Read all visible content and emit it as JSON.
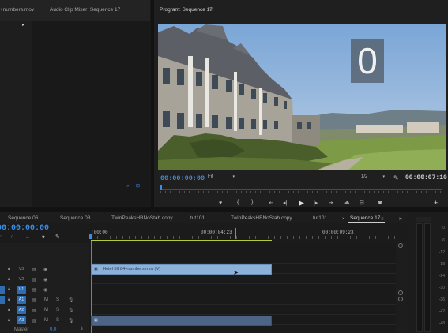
{
  "top_panels": {
    "source_tab": "+numbers.mov",
    "audio_mixer_tab": "Audio Clip Mixer: Sequence 17",
    "program_tab": "Program: Sequence 17"
  },
  "program_monitor": {
    "overlay_number": "0",
    "current_timecode": "00:00:00:00",
    "fit_label": "Fit",
    "resolution": "1/2",
    "duration_timecode": "00:00:07:10"
  },
  "timeline": {
    "timecode": "00:00:00:00",
    "tabs": [
      "Sequence 06",
      "Sequence 08",
      "TwinPeaksHBNoStab copy",
      "tut101",
      "TwinPeaksHBNoStab copy",
      "tut101",
      "Sequence 17"
    ],
    "ruler": {
      "start": ":00:00",
      "mid": "00:00:04:23",
      "end": "00:00:09:23"
    },
    "tracks": {
      "v3": "V3",
      "v2": "V2",
      "v1": "V1",
      "a1": "A1",
      "a2": "A2",
      "a3": "A3",
      "m": "M",
      "s": "S",
      "master": "Master",
      "master_val": "0.0"
    },
    "clip_label": "Hotel 59 84+numbers.mov [V]"
  },
  "audio_meter": {
    "ticks": [
      "0",
      "-6",
      "-12",
      "-18",
      "-24",
      "-30",
      "-36",
      "-42",
      "-48"
    ]
  },
  "colors": {
    "accent": "#3a8ee6",
    "clip_video": "#8bb0d9",
    "clip_audio": "#4c6587",
    "playhead_line": "#b6c93e"
  }
}
